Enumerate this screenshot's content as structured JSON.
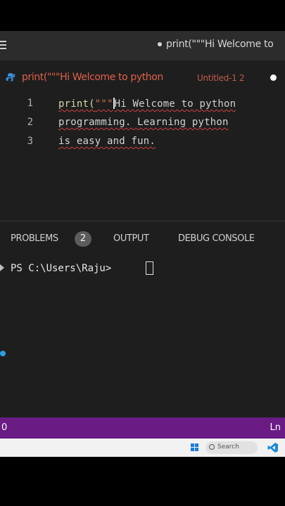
{
  "window": {
    "title_tab": "print(\"\"\"Hi Welcome to"
  },
  "editor_tab": {
    "label": "print(\"\"\"Hi Welcome to python",
    "subtitle": "Untitled-1 2"
  },
  "editor": {
    "lines": [
      {
        "number": "1",
        "fn": "print(",
        "quote": "\"\"\"",
        "text": "Hi Welcome to python"
      },
      {
        "number": "2",
        "text": "programming. Learning python"
      },
      {
        "number": "3",
        "text": "is easy and fun."
      }
    ]
  },
  "panel": {
    "tabs": [
      {
        "label": "PROBLEMS"
      },
      {
        "label": "OUTPUT"
      },
      {
        "label": "DEBUG CONSOLE"
      }
    ],
    "problems_count": "2"
  },
  "terminal": {
    "prompt": "PS C:\\Users\\Raju>"
  },
  "statusbar": {
    "left": "0",
    "right": "Ln"
  },
  "taskbar": {
    "search_placeholder": "Search"
  },
  "colors": {
    "statusbar": "#6a1b84",
    "error_tab": "#e0604a",
    "editor_bg": "#1e1e1e"
  }
}
